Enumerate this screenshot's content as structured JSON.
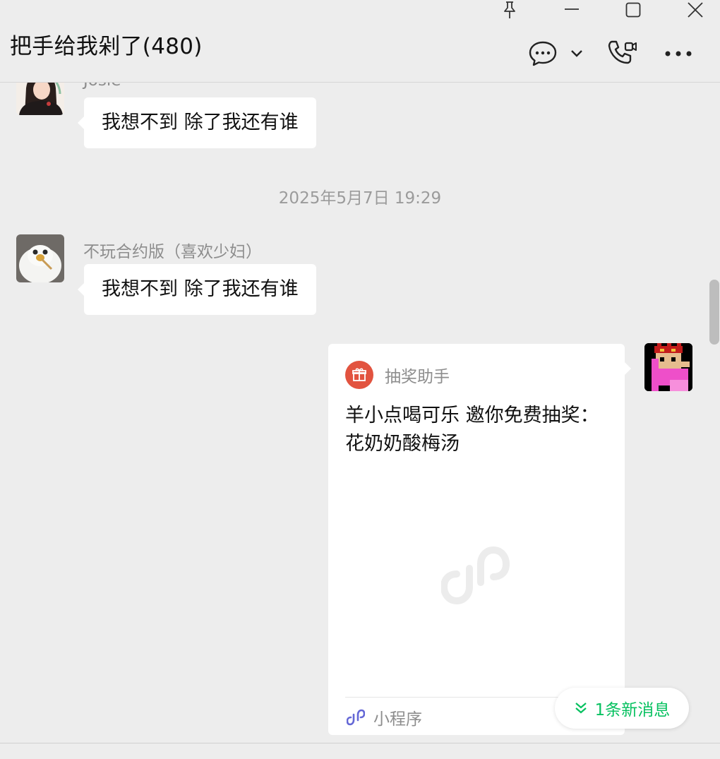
{
  "window": {
    "title": "把手给我剁了(480)",
    "controls": [
      "pin-icon",
      "minimize-icon",
      "maximize-icon",
      "close-icon"
    ]
  },
  "header_actions": [
    "chat-bubble-icon",
    "chevron-down-icon",
    "video-call-icon",
    "more-icon"
  ],
  "messages": [
    {
      "sender": "Josie",
      "text": "我想不到 除了我还有谁"
    },
    {
      "timestamp": "2025年5月7日 19:29"
    },
    {
      "sender": "不玩合约版（喜欢少妇）",
      "text": "我想不到 除了我还有谁"
    },
    {
      "mine": true,
      "card": {
        "app_name": "抽奖助手",
        "text": "羊小点喝可乐 邀你免费抽奖：花奶奶酸梅汤",
        "footer_label": "小程序"
      }
    }
  ],
  "new_message_button": {
    "label": "1条新消息"
  },
  "colors": {
    "background": "#ededed",
    "accent_green": "#07c160",
    "gift_red": "#e2533f",
    "miniprogram_purple": "#6467d6"
  }
}
